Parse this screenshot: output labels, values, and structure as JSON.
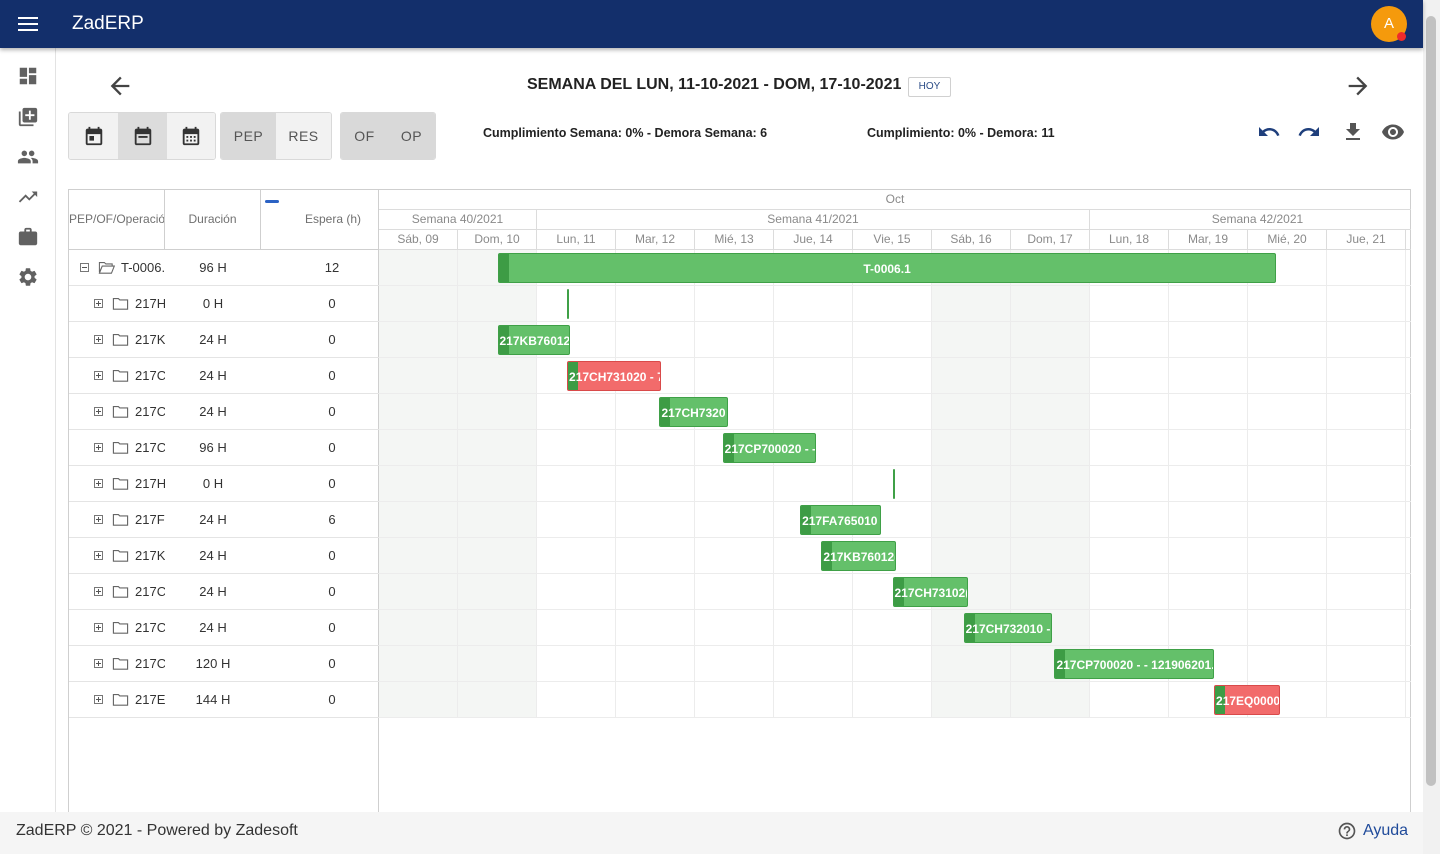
{
  "app": {
    "title": "ZadERP",
    "avatar_letter": "A"
  },
  "sidebar": {
    "items": [
      {
        "name": "dashboard-icon"
      },
      {
        "name": "library-icon"
      },
      {
        "name": "people-icon"
      },
      {
        "name": "trending-up-icon"
      },
      {
        "name": "briefcase-icon"
      },
      {
        "name": "settings-icon"
      }
    ]
  },
  "header": {
    "week_title": "SEMANA DEL LUN, 11-10-2021 - DOM, 17-10-2021",
    "today_label": "HOY"
  },
  "toolbar": {
    "view_pep": "PEP",
    "view_res": "RES",
    "view_of": "OF",
    "view_op": "OP",
    "stat_week": "Cumplimiento Semana: 0% - Demora Semana: 6",
    "stat_total": "Cumplimiento: 0% - Demora: 11"
  },
  "grid": {
    "col_name": "PEP/OF/Operación",
    "col_duration": "Duración",
    "col_wait": "Espera (h)",
    "rows": [
      {
        "name": "T-0006.",
        "duration": "96 H",
        "wait": "12"
      },
      {
        "name": "217H",
        "duration": "0 H",
        "wait": "0"
      },
      {
        "name": "217K",
        "duration": "24 H",
        "wait": "0"
      },
      {
        "name": "217C",
        "duration": "24 H",
        "wait": "0"
      },
      {
        "name": "217C",
        "duration": "24 H",
        "wait": "0"
      },
      {
        "name": "217C",
        "duration": "96 H",
        "wait": "0"
      },
      {
        "name": "217H",
        "duration": "0 H",
        "wait": "0"
      },
      {
        "name": "217F",
        "duration": "24 H",
        "wait": "6"
      },
      {
        "name": "217K",
        "duration": "24 H",
        "wait": "0"
      },
      {
        "name": "217C",
        "duration": "24 H",
        "wait": "0"
      },
      {
        "name": "217C",
        "duration": "24 H",
        "wait": "0"
      },
      {
        "name": "217C",
        "duration": "120 H",
        "wait": "0"
      },
      {
        "name": "217E",
        "duration": "144 H",
        "wait": "0"
      }
    ]
  },
  "timeline": {
    "month": "Oct",
    "weeks": [
      "Semana 40/2021",
      "Semana 41/2021",
      "Semana 42/2021"
    ],
    "days": [
      "Sáb, 09",
      "Dom, 10",
      "Lun, 11",
      "Mar, 12",
      "Mié, 13",
      "Jue, 14",
      "Vie, 15",
      "Sáb, 16",
      "Dom, 17",
      "Lun, 18",
      "Mar, 19",
      "Mié, 20",
      "Jue, 21"
    ],
    "bars": [
      {
        "label": "T-0006.1",
        "color": "green"
      },
      {
        "label": "",
        "color": "green"
      },
      {
        "label": "217KB76012",
        "color": "green"
      },
      {
        "label": "217CH731020 - 7",
        "color": "red"
      },
      {
        "label": "217CH7320",
        "color": "green"
      },
      {
        "label": "217CP700020 - -",
        "color": "green"
      },
      {
        "label": "",
        "color": "green"
      },
      {
        "label": "217FA765010",
        "color": "green"
      },
      {
        "label": "217KB76012(",
        "color": "green"
      },
      {
        "label": "217CH73102(",
        "color": "green"
      },
      {
        "label": "217CH732010 -",
        "color": "green"
      },
      {
        "label": "217CP700020 - - 121906201.",
        "color": "green"
      },
      {
        "label": "217EQ00000",
        "color": "red"
      }
    ]
  },
  "footer": {
    "text": "ZadERP © 2021 - Powered by Zadesoft",
    "help": "Ayuda"
  }
}
